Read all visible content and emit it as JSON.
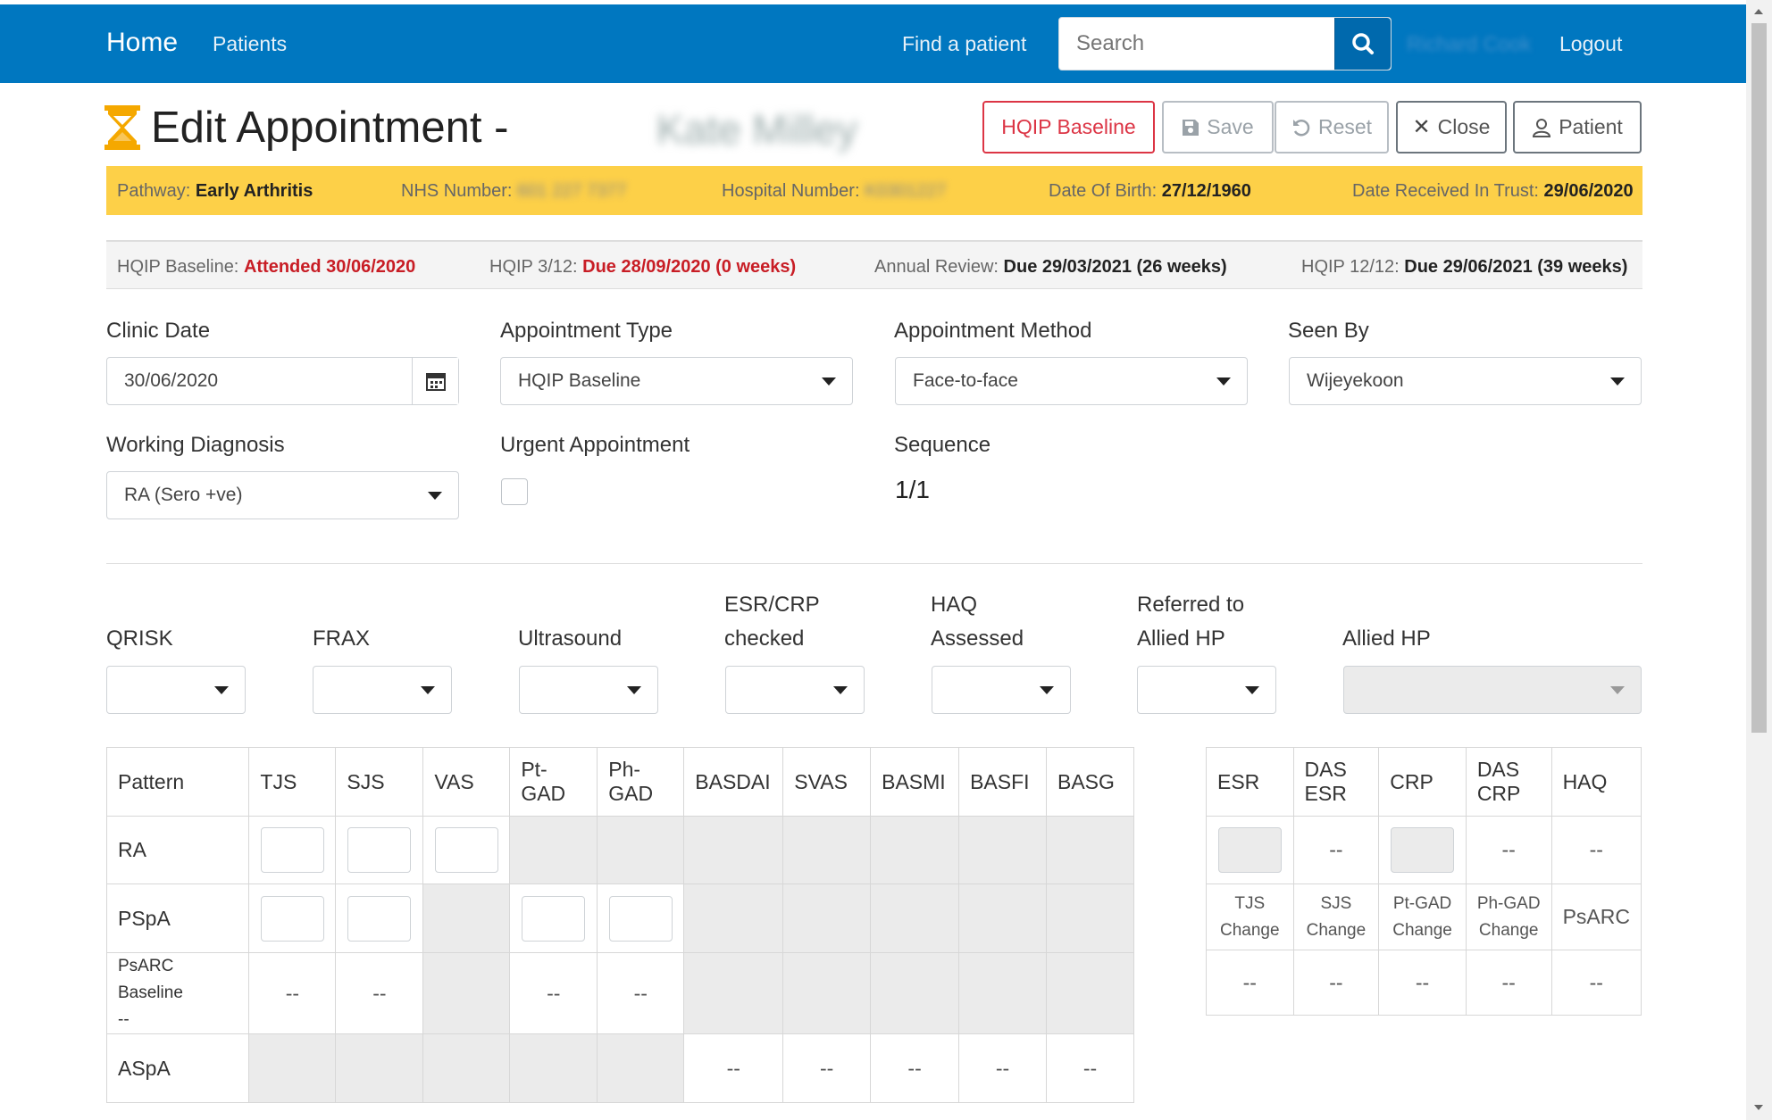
{
  "nav": {
    "brand": "Home",
    "patients": "Patients",
    "find": "Find a patient",
    "search_placeholder": "Search",
    "user": "Richard Cook",
    "logout": "Logout"
  },
  "title": {
    "text": "Edit Appointment -",
    "patient_name": "Kate Milley"
  },
  "buttons": {
    "hqip": "HQIP Baseline",
    "save": "Save",
    "reset": "Reset",
    "close": "Close",
    "patient": "Patient"
  },
  "pathway": {
    "pathway_label": "Pathway:",
    "pathway_value": "Early Arthritis",
    "nhs_label": "NHS Number:",
    "nhs_value": "601 227 7377",
    "hosp_label": "Hospital Number:",
    "hosp_value": "K0301227",
    "dob_label": "Date Of Birth:",
    "dob_value": "27/12/1960",
    "received_label": "Date Received In Trust:",
    "received_value": "29/06/2020"
  },
  "hqip": {
    "baseline_label": "HQIP Baseline:",
    "baseline_value": "Attended 30/06/2020",
    "m3_label": "HQIP 3/12:",
    "m3_value": "Due 28/09/2020 (0 weeks)",
    "annual_label": "Annual Review:",
    "annual_value": "Due 29/03/2021 (26 weeks)",
    "m12_label": "HQIP 12/12:",
    "m12_value": "Due 29/06/2021 (39 weeks)"
  },
  "form": {
    "clinic_date_label": "Clinic Date",
    "clinic_date": "30/06/2020",
    "appt_type_label": "Appointment Type",
    "appt_type": "HQIP Baseline",
    "appt_method_label": "Appointment Method",
    "appt_method": "Face-to-face",
    "seen_by_label": "Seen By",
    "seen_by": "Wijeyekoon",
    "diagnosis_label": "Working Diagnosis",
    "diagnosis": "RA (Sero +ve)",
    "urgent_label": "Urgent Appointment",
    "sequence_label": "Sequence",
    "sequence": "1/1"
  },
  "assessments": {
    "qrisk": "QRISK",
    "frax": "FRAX",
    "ultrasound": "Ultrasound",
    "esr_crp_1": "ESR/CRP",
    "esr_crp_2": "checked",
    "haq_1": "HAQ",
    "haq_2": "Assessed",
    "ref_1": "Referred to",
    "ref_2": "Allied HP",
    "allied": "Allied HP"
  },
  "scores": {
    "headers": [
      "Pattern",
      "TJS",
      "SJS",
      "VAS",
      "Pt-GAD",
      "Ph-GAD",
      "BASDAI",
      "SVAS",
      "BASMI",
      "BASFI",
      "BASG"
    ],
    "ra": "RA",
    "pspa": "PSpA",
    "psarc": "PsARC Baseline",
    "aspa": "ASpA",
    "dash": "--"
  },
  "labs": {
    "headers": [
      "ESR",
      "DAS ESR",
      "CRP",
      "DAS CRP",
      "HAQ"
    ],
    "changes": [
      "TJS Change",
      "SJS Change",
      "Pt-GAD Change",
      "Ph-GAD Change",
      "PsARC"
    ],
    "dash": "--"
  }
}
